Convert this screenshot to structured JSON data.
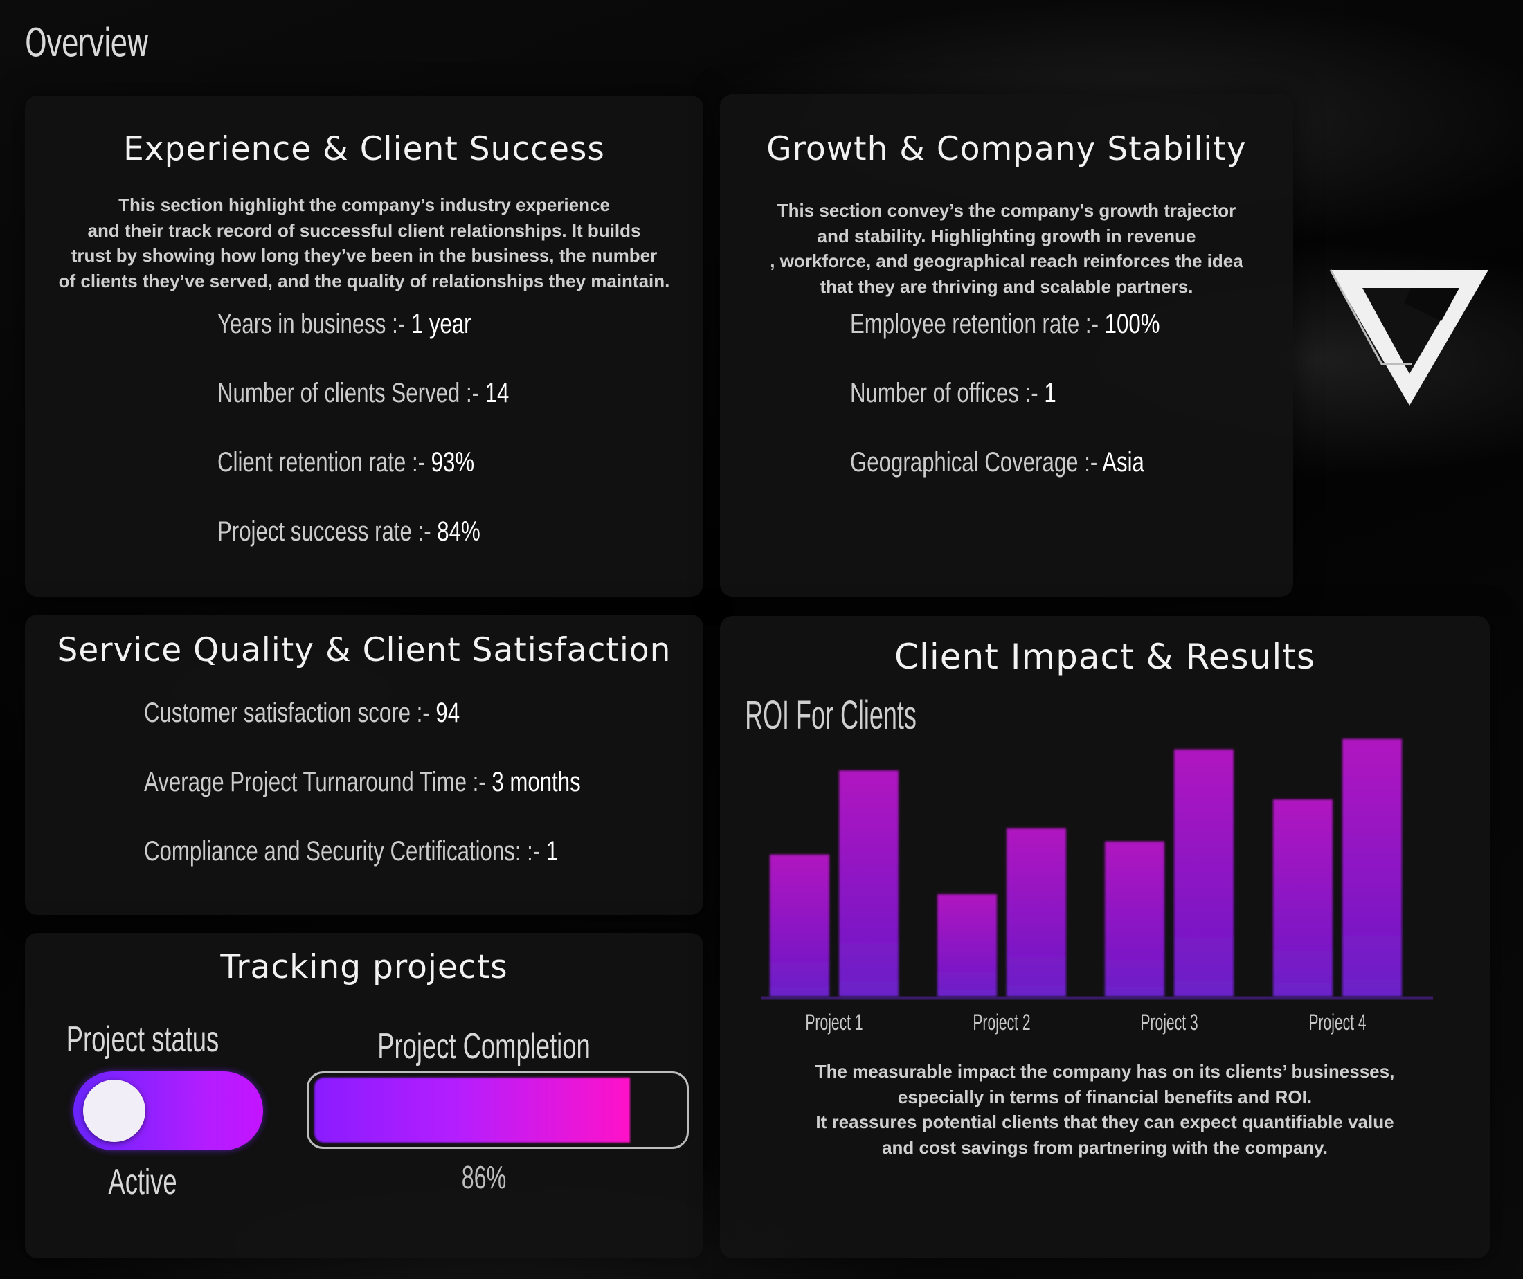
{
  "page": {
    "title": "Overview"
  },
  "experience": {
    "title": "Experience & Client Success",
    "description": [
      "This section highlight the company’s industry experience",
      "and their track record of successful client relationships. It builds",
      "trust by showing how long they’ve been in the business, the number",
      "of clients they’ve served, and the quality of relationships they maintain."
    ],
    "stats": [
      {
        "label": "Years in business :- ",
        "value": "1 year"
      },
      {
        "label": "Number of clients Served :- ",
        "value": "14"
      },
      {
        "label": "Client retention rate :- ",
        "value": "93%"
      },
      {
        "label": "Project success rate :- ",
        "value": "84%"
      }
    ]
  },
  "growth": {
    "title": "Growth & Company Stability",
    "description": [
      "This section convey’s the company's growth trajector",
      "and stability. Highlighting growth in revenue",
      ", workforce, and geographical reach reinforces the idea",
      "that they are thriving and scalable partners."
    ],
    "stats": [
      {
        "label": "Employee retention rate :- ",
        "value": "100%"
      },
      {
        "label": "Number of offices :- ",
        "value": "1"
      },
      {
        "label": "Geographical Coverage :- ",
        "value": "Asia"
      }
    ]
  },
  "service": {
    "title": "Service Quality & Client Satisfaction",
    "stats": [
      {
        "label": "Customer satisfaction score :- ",
        "value": "94"
      },
      {
        "label": "Average Project Turnaround Time :- ",
        "value": "3 months"
      },
      {
        "label": "Compliance and Security Certifications: :- ",
        "value": "1"
      }
    ]
  },
  "tracking": {
    "title": "Tracking projects",
    "status_label": "Project status",
    "status_value": "Active",
    "toggle_on": true,
    "completion_label": "Project Completion",
    "completion_text": "86%",
    "completion_fraction": 0.86
  },
  "impact": {
    "title": "Client Impact & Results",
    "chart_title": "ROI For Clients",
    "description": [
      "The measurable impact the company has on its clients’ businesses,",
      "especially in terms of financial benefits and ROI.",
      "It reassures potential clients that they can expect quantifiable value",
      "and cost savings from partnering with the company."
    ]
  },
  "colors": {
    "accent_purple": "#8c1ce0",
    "accent_magenta": "#ff12c8",
    "bar_top": "#b015c0",
    "bar_bottom": "#6a22c8"
  },
  "logo": {
    "icon": "inverted-triangle-logo"
  },
  "chart_data": {
    "type": "bar",
    "title": "ROI For Clients",
    "categories": [
      "Project 1",
      "Project 2",
      "Project 3",
      "Project 4"
    ],
    "series": [
      {
        "values": [
          54,
          39,
          59,
          75
        ]
      },
      {
        "values": [
          86,
          64,
          94,
          98
        ]
      }
    ],
    "ylim": [
      0,
      100
    ],
    "xlabel": "",
    "ylabel": "",
    "grid": false,
    "legend": "none"
  }
}
